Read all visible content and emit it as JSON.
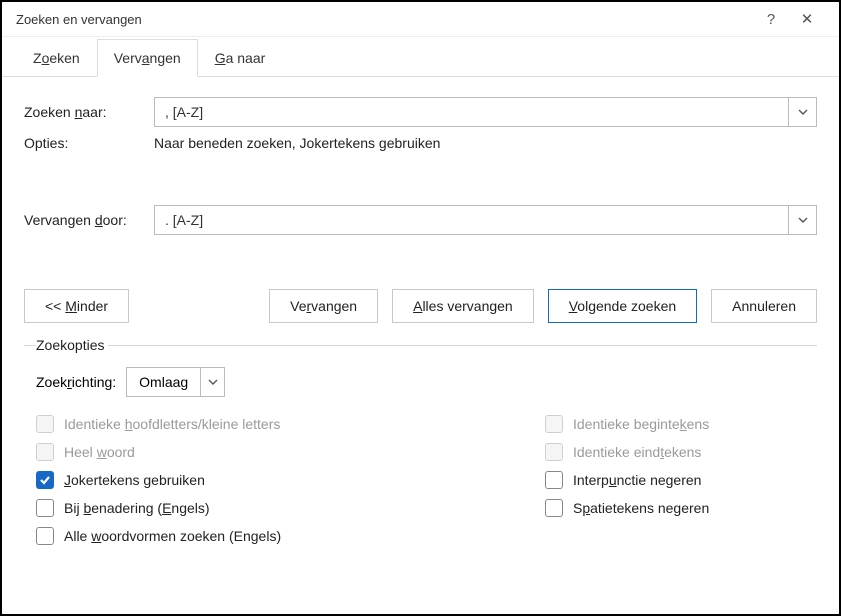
{
  "title": "Zoeken en vervangen",
  "tabs": {
    "search": {
      "pre": "Z",
      "u": "o",
      "post": "eken"
    },
    "replace": {
      "pre": "Verv",
      "u": "a",
      "post": "ngen"
    },
    "goto": {
      "pre": "",
      "u": "G",
      "post": "a naar"
    }
  },
  "find": {
    "label_pre": "Zoeken ",
    "label_u": "n",
    "label_post": "aar:",
    "value": ", [A-Z]"
  },
  "options": {
    "label": "Opties:",
    "text": "Naar beneden zoeken, Jokertekens gebruiken"
  },
  "replace_with": {
    "label_pre": "Vervangen ",
    "label_u": "d",
    "label_post": "oor:",
    "value": ". [A-Z]"
  },
  "buttons": {
    "less": {
      "pre": "<< ",
      "u": "M",
      "post": "inder"
    },
    "replace": {
      "pre": "Ve",
      "u": "r",
      "post": "vangen"
    },
    "replace_all": {
      "pre": "",
      "u": "A",
      "post": "lles vervangen"
    },
    "find_next": {
      "pre": "",
      "u": "V",
      "post": "olgende zoeken"
    },
    "cancel": "Annuleren"
  },
  "search_opts": {
    "legend": "Zoekopties",
    "direction_label": {
      "pre": "Zoek",
      "u": "r",
      "post": "ichting:"
    },
    "direction_value": "Omlaag",
    "checks": {
      "match_case": {
        "pre": "Identieke ",
        "u": "h",
        "post": "oofdletters/kleine letters",
        "disabled": true,
        "checked": false
      },
      "whole_word": {
        "pre": "Heel ",
        "u": "w",
        "post": "oord",
        "disabled": true,
        "checked": false
      },
      "wildcards": {
        "pre": "",
        "u": "J",
        "post": "okertekens gebruiken",
        "disabled": false,
        "checked": true
      },
      "sounds_like": {
        "pre": "Bij ",
        "u": "b",
        "post": "enadering (",
        "u2": "E",
        "post2": "ngels)",
        "disabled": false,
        "checked": false
      },
      "all_forms": {
        "pre": "Alle ",
        "u": "w",
        "post": "oordvormen zoeken (Engels)",
        "disabled": false,
        "checked": false
      },
      "match_prefix": {
        "pre": "Identieke beginte",
        "u": "k",
        "post": "ens",
        "disabled": true,
        "checked": false
      },
      "match_suffix": {
        "pre": "Identieke eind",
        "u": "t",
        "post": "ekens",
        "disabled": true,
        "checked": false
      },
      "ignore_punct": {
        "pre": "Interp",
        "u": "u",
        "post": "nctie negeren",
        "disabled": false,
        "checked": false
      },
      "ignore_white": {
        "pre": "S",
        "u": "p",
        "post": "atietekens negeren",
        "disabled": false,
        "checked": false
      }
    }
  }
}
